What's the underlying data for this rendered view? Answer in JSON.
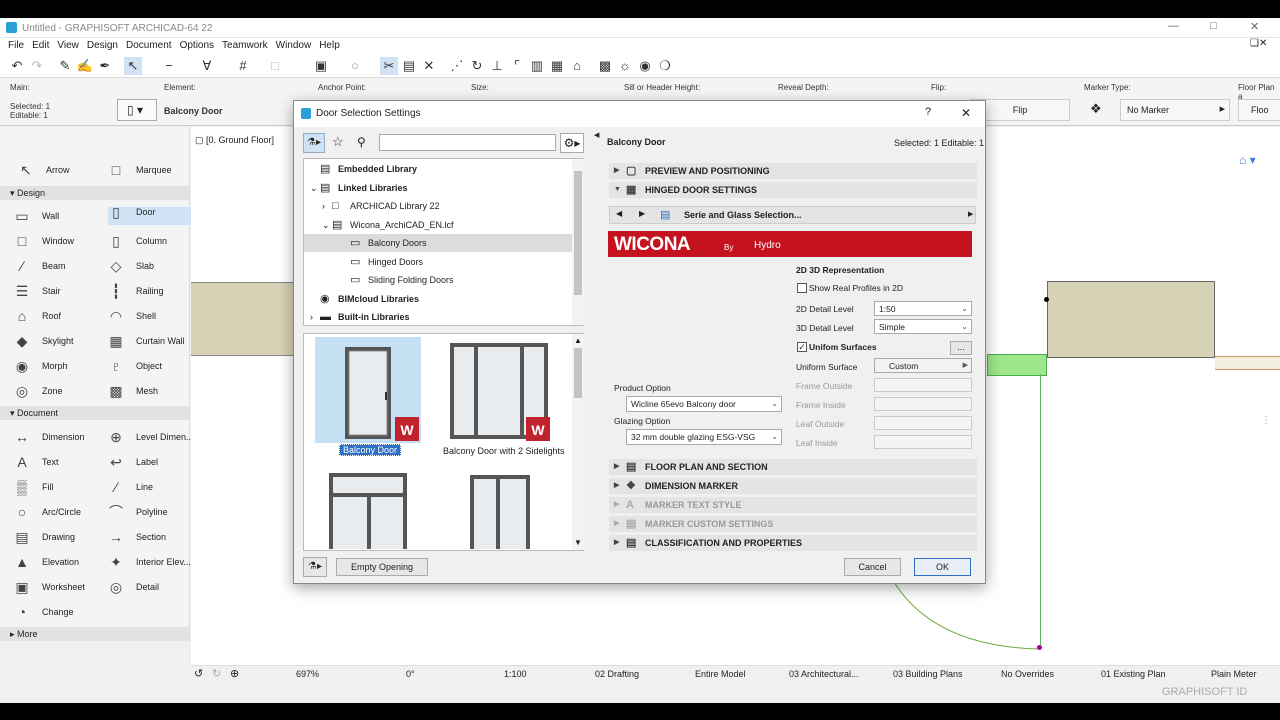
{
  "app": {
    "title": "Untitled - GRAPHISOFT ARCHICAD-64 22",
    "menu": [
      "File",
      "Edit",
      "View",
      "Design",
      "Document",
      "Options",
      "Teamwork",
      "Window",
      "Help"
    ]
  },
  "infobox": {
    "main_label": "Main:",
    "selected": "Selected: 1",
    "editable": "Editable: 1",
    "element_label": "Element:",
    "element_value": "Balcony Door",
    "anchor_label": "Anchor Point:",
    "size_label": "Size:",
    "sill_label": "Sill or Header Height:",
    "reveal_label": "Reveal Depth:",
    "flip_label": "Flip:",
    "flip_btn": "Flip",
    "marker_label": "Marker Type:",
    "marker_value": "No Marker",
    "floorplan_label": "Floor Plan a",
    "floorplan_value": "Floo"
  },
  "toolbox": {
    "top": [
      {
        "label": "Arrow",
        "icon": "arrow-icon"
      },
      {
        "label": "Marquee",
        "icon": "marquee-icon"
      }
    ],
    "design_label": "Design",
    "design": [
      {
        "label": "Wall",
        "icon": "wall-icon"
      },
      {
        "label": "Door",
        "icon": "door-icon"
      },
      {
        "label": "Window",
        "icon": "window-icon"
      },
      {
        "label": "Column",
        "icon": "column-icon"
      },
      {
        "label": "Beam",
        "icon": "beam-icon"
      },
      {
        "label": "Slab",
        "icon": "slab-icon"
      },
      {
        "label": "Stair",
        "icon": "stair-icon"
      },
      {
        "label": "Railing",
        "icon": "railing-icon"
      },
      {
        "label": "Roof",
        "icon": "roof-icon"
      },
      {
        "label": "Shell",
        "icon": "shell-icon"
      },
      {
        "label": "Skylight",
        "icon": "skylight-icon"
      },
      {
        "label": "Curtain Wall",
        "icon": "curtain-wall-icon"
      },
      {
        "label": "Morph",
        "icon": "morph-icon"
      },
      {
        "label": "Object",
        "icon": "object-icon"
      },
      {
        "label": "Zone",
        "icon": "zone-icon"
      },
      {
        "label": "Mesh",
        "icon": "mesh-icon"
      }
    ],
    "document_label": "Document",
    "document": [
      {
        "label": "Dimension",
        "icon": "dimension-icon"
      },
      {
        "label": "Level Dimen...",
        "icon": "level-dimension-icon"
      },
      {
        "label": "Text",
        "icon": "text-icon"
      },
      {
        "label": "Label",
        "icon": "label-icon"
      },
      {
        "label": "Fill",
        "icon": "fill-icon"
      },
      {
        "label": "Line",
        "icon": "line-icon"
      },
      {
        "label": "Arc/Circle",
        "icon": "arc-circle-icon"
      },
      {
        "label": "Polyline",
        "icon": "polyline-icon"
      },
      {
        "label": "Drawing",
        "icon": "drawing-icon"
      },
      {
        "label": "Section",
        "icon": "section-icon"
      },
      {
        "label": "Elevation",
        "icon": "elevation-icon"
      },
      {
        "label": "Interior Elev...",
        "icon": "interior-elevation-icon"
      },
      {
        "label": "Worksheet",
        "icon": "worksheet-icon"
      },
      {
        "label": "Detail",
        "icon": "detail-icon"
      },
      {
        "label": "Change",
        "icon": "change-icon"
      }
    ],
    "more_label": "More"
  },
  "canvas": {
    "tab": "[0. Ground Floor]"
  },
  "status": {
    "zoom": "697%",
    "angle": "0°",
    "scale": "1:100",
    "layer": "02 Drafting",
    "model": "Entire Model",
    "pen": "03 Architectural...",
    "plans": "03 Building Plans",
    "overrides": "No Overrides",
    "renovation": "01 Existing Plan",
    "dim": "Plain Meter"
  },
  "brand": "GRAPHISOFT ID",
  "dialog": {
    "title": "Door Selection Settings",
    "help": "?",
    "close": "✕",
    "search_placeholder": "",
    "tree": [
      "Embedded Library",
      "Linked Libraries",
      "ARCHICAD Library 22",
      "Wicona_ArchiCAD_EN.lcf",
      "Balcony Doors",
      "Hinged Doors",
      "Sliding Folding Doors",
      "BIMcloud Libraries",
      "Built-in Libraries"
    ],
    "items": [
      {
        "name": "Balcony Door"
      },
      {
        "name": "Balcony Door with 2 Sidelights"
      }
    ],
    "empty_opening": "Empty Opening",
    "element_name": "Balcony Door",
    "selected_info": "Selected: 1 Editable: 1",
    "sections": {
      "preview": "PREVIEW AND POSITIONING",
      "hinged": "HINGED DOOR SETTINGS",
      "floor": "FLOOR PLAN AND SECTION",
      "dim": "DIMENSION MARKER",
      "mtext": "MARKER TEXT STYLE",
      "mcustom": "MARKER CUSTOM SETTINGS",
      "class": "CLASSIFICATION AND PROPERTIES"
    },
    "serie": "Serie and Glass Selection...",
    "logo_main": "WICONA",
    "logo_by": "By",
    "logo_hydro": "Hydro",
    "product_label": "Product Option",
    "product_value": "Wicline 65evo Balcony door",
    "glazing_label": "Glazing Option",
    "glazing_value": "32 mm double glazing ESG-VSG",
    "rep_title": "2D 3D Representation",
    "show_real": "Show Real Profiles in 2D",
    "detail2d_label": "2D Detail Level",
    "detail2d_value": "1:50",
    "detail3d_label": "3D Detail Level",
    "detail3d_value": "Simple",
    "unifom": "Unifom Surfaces",
    "dots": "...",
    "uni_surface_label": "Uniform Surface",
    "uni_surface_value": "Custom",
    "frame_out": "Frame Outside",
    "frame_in": "Frame Inside",
    "leaf_out": "Leaf Outside",
    "leaf_in": "Leaf Inside",
    "cancel": "Cancel",
    "ok": "OK"
  }
}
